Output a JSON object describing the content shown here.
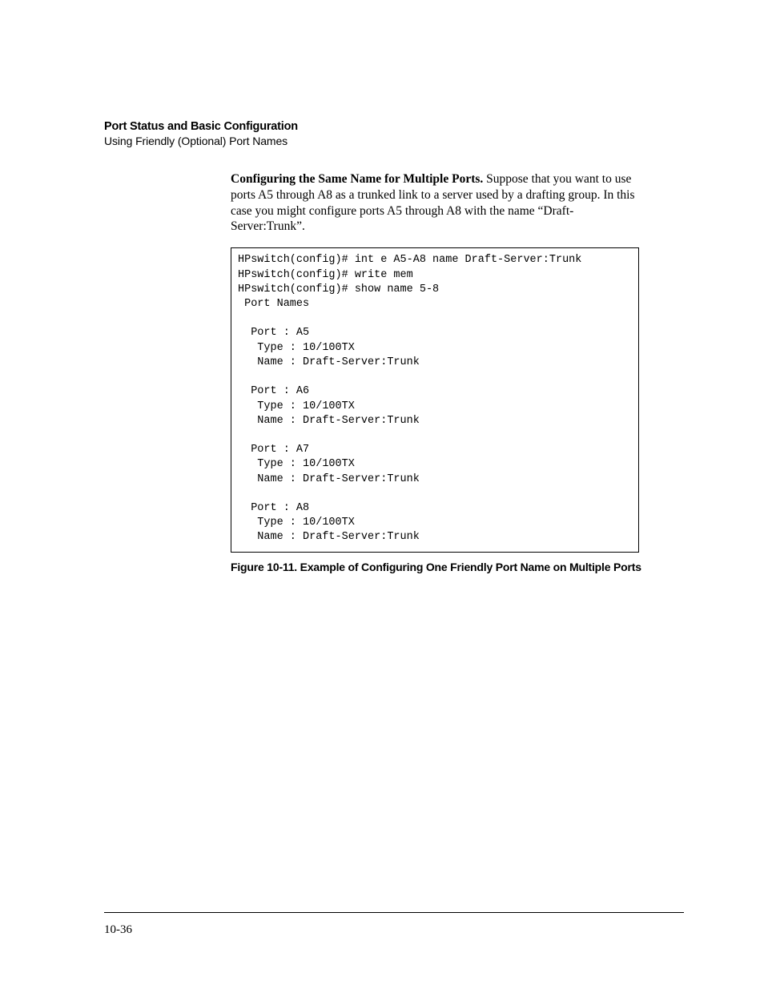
{
  "header": {
    "title": "Port Status and Basic Configuration",
    "subtitle": "Using Friendly (Optional) Port Names"
  },
  "paragraph": {
    "lead": "Configuring the Same Name for Multiple Ports.",
    "body": "  Suppose that you want to use ports A5 through A8 as a trunked link to a server used by a drafting group. In this case you might configure ports A5 through A8 with the name “Draft-Server:Trunk”."
  },
  "code": "HPswitch(config)# int e A5-A8 name Draft-Server:Trunk\nHPswitch(config)# write mem\nHPswitch(config)# show name 5-8\n Port Names\n\n  Port : A5\n   Type : 10/100TX\n   Name : Draft-Server:Trunk\n\n  Port : A6\n   Type : 10/100TX\n   Name : Draft-Server:Trunk\n\n  Port : A7\n   Type : 10/100TX\n   Name : Draft-Server:Trunk\n\n  Port : A8\n   Type : 10/100TX\n   Name : Draft-Server:Trunk",
  "figure_caption": "Figure 10-11.  Example of Configuring One Friendly Port Name on Multiple Ports",
  "page_number": "10-36"
}
